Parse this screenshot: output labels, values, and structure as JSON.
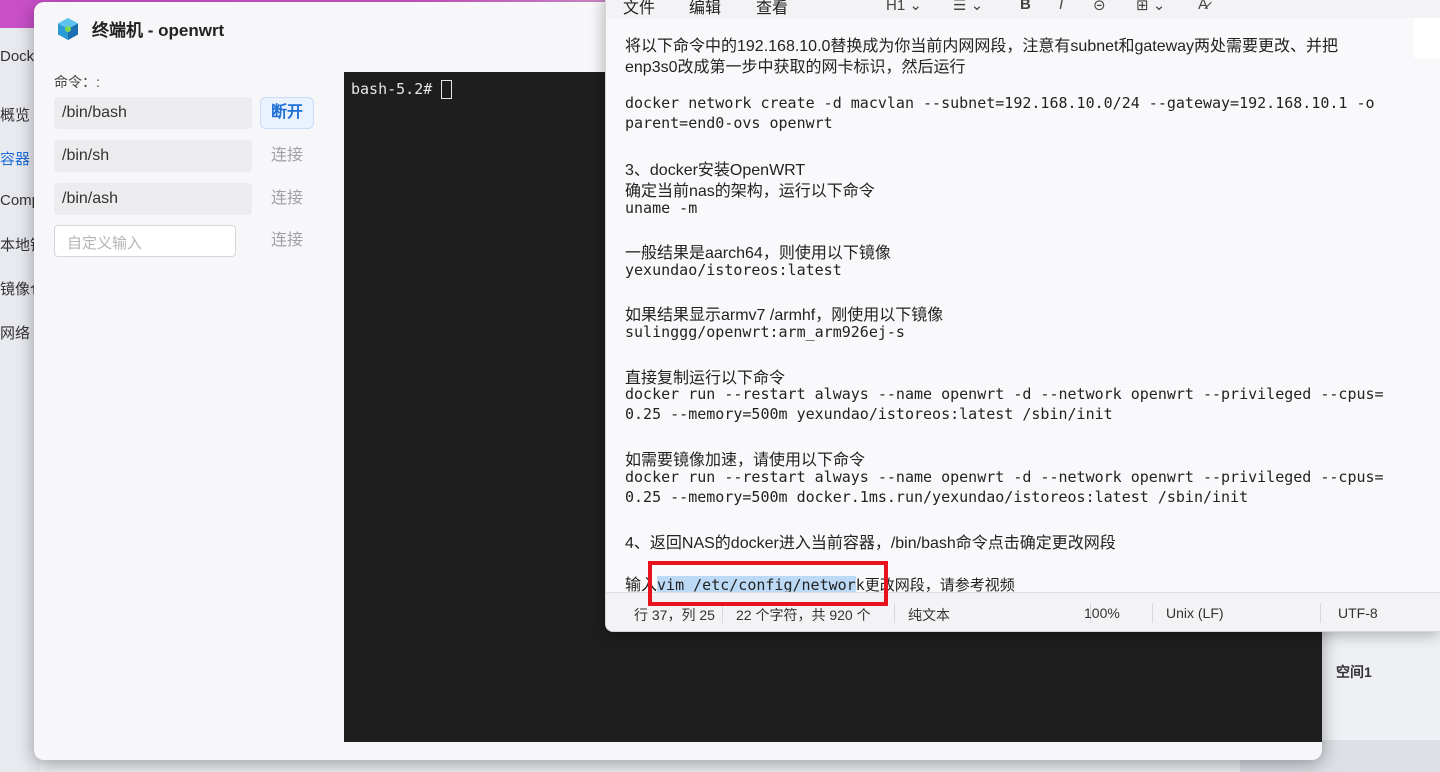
{
  "background_app": {
    "brand": "Dock",
    "sidebar": [
      {
        "label": "概览",
        "active": false
      },
      {
        "label": "容器",
        "active": true
      },
      {
        "label": "Compose",
        "active": false
      },
      {
        "label": "本地镜像",
        "active": false
      },
      {
        "label": "镜像仓库",
        "active": false
      },
      {
        "label": "网络",
        "active": false
      }
    ],
    "right_label": "空间1"
  },
  "terminal_window": {
    "title": "终端机 - openwrt",
    "command_label": "命令：:",
    "commands": [
      {
        "value": "/bin/bash",
        "button": "断开",
        "connected": true
      },
      {
        "value": "/bin/sh",
        "button": "连接",
        "connected": false
      },
      {
        "value": "/bin/ash",
        "button": "连接",
        "connected": false
      }
    ],
    "custom_input": {
      "placeholder": "自定义输入",
      "button": "连接"
    },
    "prompt": "bash-5.2#"
  },
  "notepad": {
    "menus": [
      "文件",
      "编辑",
      "查看"
    ],
    "toolbar": {
      "heading": "H1",
      "list": "☰",
      "bold": "B",
      "italic": "I",
      "link": "⊝",
      "table": "⊞",
      "clear": "A̷"
    },
    "content": {
      "l1": "将以下命令中的192.168.10.0替换成为你当前内网网段，注意有subnet和gateway两处需要更改、并把",
      "l2": "enp3s0改成第一步中获取的网卡标识，然后运行",
      "l3": "docker network create -d macvlan --subnet=192.168.10.0/24 --gateway=192.168.10.1 -o",
      "l4": "parent=end0-ovs openwrt",
      "l5": "3、docker安装OpenWRT",
      "l6": "确定当前nas的架构，运行以下命令",
      "l7": "uname -m",
      "l8": "一般结果是aarch64，则使用以下镜像",
      "l9": "yexundao/istoreos:latest",
      "l10": "如果结果显示armv7 /armhf，刚使用以下镜像",
      "l11": "sulinggg/openwrt:arm_arm926ej-s",
      "l12": "直接复制运行以下命令",
      "l13": "docker run --restart always --name openwrt -d --network openwrt --privileged --cpus=",
      "l14": "0.25 --memory=500m yexundao/istoreos:latest /sbin/init",
      "l15": "如需要镜像加速，请使用以下命令",
      "l16": "docker run --restart always --name openwrt -d --network openwrt --privileged --cpus=",
      "l17": "0.25 --memory=500m docker.1ms.run/yexundao/istoreos:latest /sbin/init",
      "l18": "4、返回NAS的docker进入当前容器，/bin/bash命令点击确定更改网段",
      "l19_pre": "输入",
      "l19_sel": "vim /etc/config/networ",
      "l19_post": "k更改网段，请参考视频"
    },
    "status": {
      "position": "行 37，列 25",
      "selection": "22 个字符，共 920 个",
      "format": "纯文本",
      "zoom": "100%",
      "line_ending": "Unix (LF)",
      "encoding": "UTF-8"
    }
  },
  "colors": {
    "accent": "#1f6fd6",
    "highlight": "#e8121e",
    "selection": "#bcd9f5",
    "terminal_bg": "#1e1e1e"
  }
}
